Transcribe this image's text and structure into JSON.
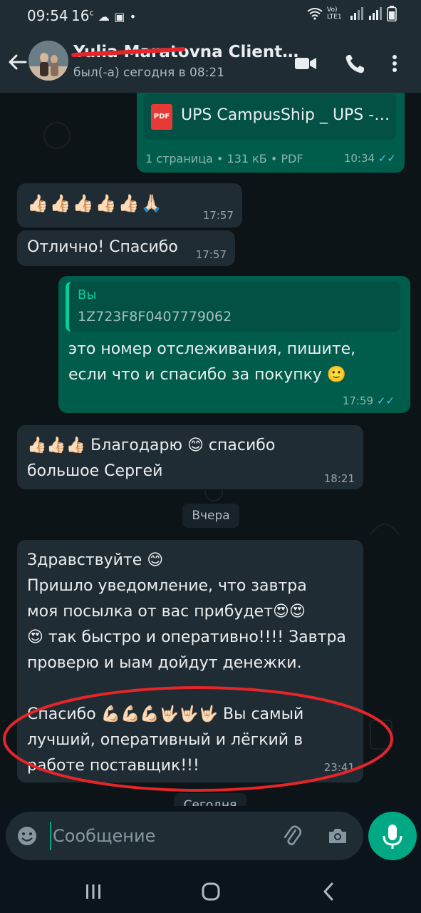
{
  "status_bar": {
    "time": "09:54",
    "extra": "16",
    "network": "Vo) LTE1",
    "battery_icon": "battery-icon"
  },
  "header": {
    "contact_name": "Yulia Maratovna Client…",
    "last_seen": "был(-а) сегодня в 08:21"
  },
  "messages": [
    {
      "id": "doc",
      "direction": "out",
      "document_name": "UPS CampusShip _ UPS -…",
      "document_meta": "1 страница • 131 кБ • PDF",
      "time": "10:34",
      "status": "read"
    },
    {
      "id": "m1",
      "direction": "in",
      "emojis": [
        "👍🏻",
        "👍🏻",
        "👍🏻",
        "👍🏻",
        "👍🏻",
        "🙏🏻"
      ],
      "time": "17:57"
    },
    {
      "id": "m2",
      "direction": "in",
      "text": "Отлично! Спасибо",
      "time": "17:57"
    },
    {
      "id": "m3",
      "direction": "out",
      "quote_author": "Вы",
      "quote_text": "1Z723F8F0407779062",
      "line1": "это номер отслеживания, пишите,",
      "line2": "если что и спасибо за покупку 🙂",
      "time": "17:59",
      "status": "read"
    },
    {
      "id": "m4",
      "direction": "in",
      "line1": "👍🏻👍🏻👍🏻 Благодарю 😊  спасибо",
      "line2": "большое Сергей",
      "time": "18:21"
    },
    {
      "id": "m5",
      "direction": "in",
      "lines": [
        "Здравствуйте 😊",
        "Пришло уведомление,  что завтра",
        "моя посылка от вас прибудет😍😍",
        "😍 так быстро и оперативно!!!! Завтра",
        "проверю и ыам дойдут денежки.",
        "",
        "Спасибо 💪🏻💪🏻💪🏻🤟🏻🤟🏻🤟🏻 Вы самый",
        "лучший,  оперативный и лёгкий в",
        "работе  поставщик!!!"
      ],
      "time": "23:41"
    }
  ],
  "date_chips": {
    "yesterday": "Вчера",
    "today": "Сегодня"
  },
  "input": {
    "placeholder": "Сообщение"
  },
  "colors": {
    "incoming": "#202c33",
    "outgoing": "#005c4b",
    "accent": "#00a884",
    "read_ticks": "#53bdeb",
    "annotation": "#e5252a"
  }
}
